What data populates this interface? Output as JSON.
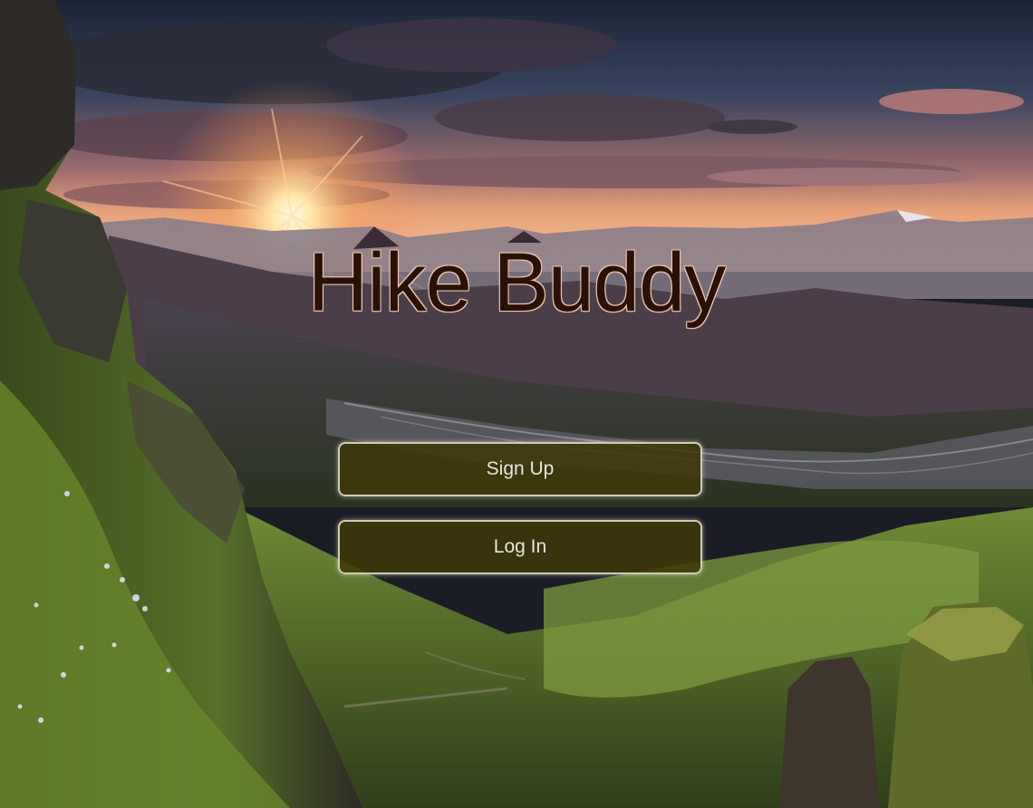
{
  "app": {
    "title": "Hike Buddy"
  },
  "actions": {
    "signup_label": "Sign Up",
    "login_label": "Log In"
  },
  "colors": {
    "button_background": "#403808",
    "button_border": "#cfcbb8",
    "button_text": "#e8e4da",
    "title_fill": "#2a1108",
    "title_outline": "#f3c7b4"
  },
  "background": {
    "icon": "mountain-sunset-landscape"
  }
}
